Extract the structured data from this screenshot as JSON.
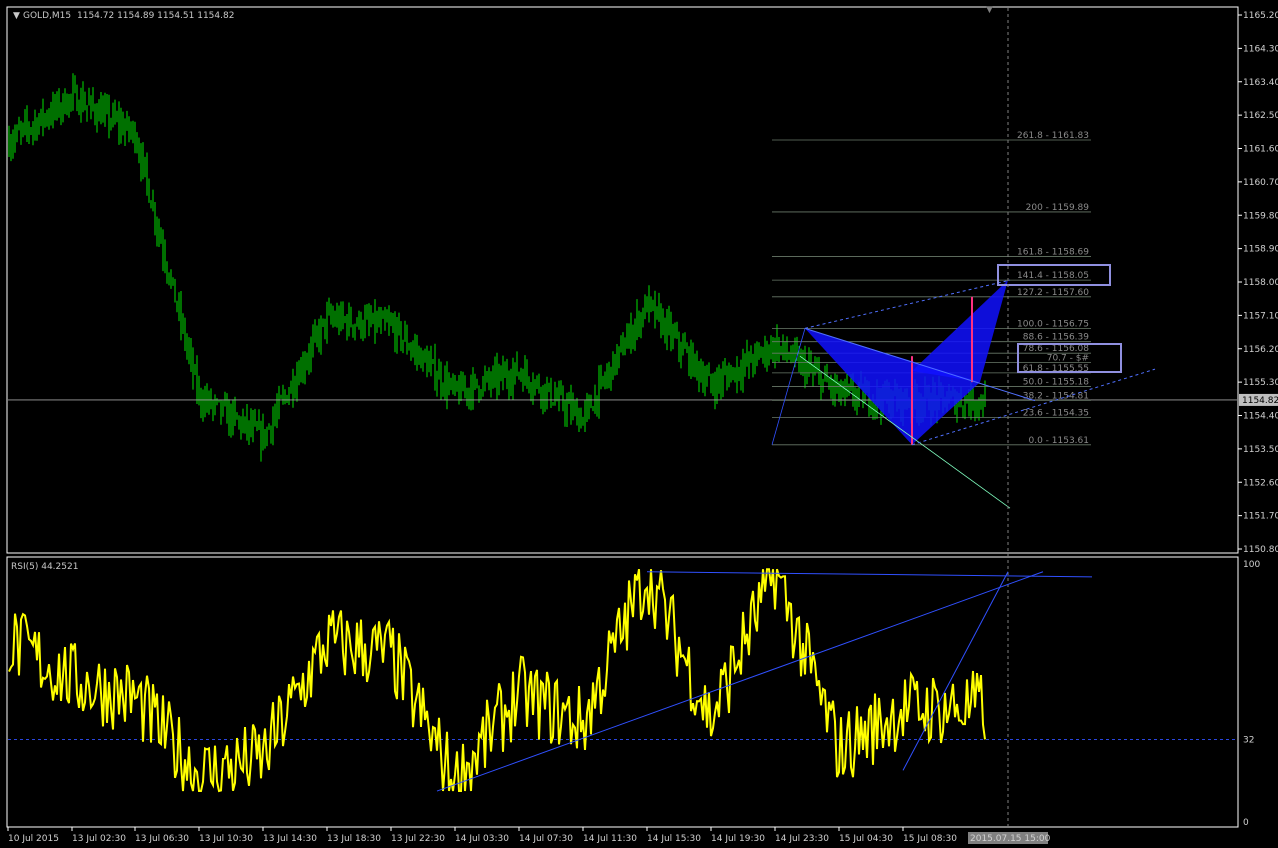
{
  "header": {
    "symbol": "GOLD,M15",
    "ohlc": "1154.72 1154.89 1154.51 1154.82"
  },
  "rsi_header": "RSI(5) 44.2521",
  "colors": {
    "background": "#000000",
    "frame": "#ffffff",
    "candles": "#00e000",
    "rsi_line": "#ffff00",
    "trend_lines": "#3050ff",
    "harmonic_fill": "#1010ff",
    "fib_lines": "#6a7a6a",
    "current_price_label_bg": "#c0c0c0",
    "time_highlight_bg": "#808080"
  },
  "chart_data": [
    {
      "type": "line",
      "subtype": "candlestick",
      "title": "GOLD,M15",
      "series": [
        {
          "name": "GOLD,M15",
          "x": [
            "10 Jul 2015",
            "13 Jul 02:30",
            "13 Jul 06:30",
            "13 Jul 10:30",
            "13 Jul 14:30",
            "13 Jul 18:30",
            "13 Jul 22:30",
            "14 Jul 03:30",
            "14 Jul 07:30",
            "14 Jul 11:30",
            "14 Jul 15:30",
            "14 Jul 19:30",
            "14 Jul 23:30",
            "15 Jul 04:30",
            "15 Jul 08:30"
          ],
          "y": [
            1161.8,
            1163.0,
            1162.0,
            1154.9,
            1153.8,
            1157.0,
            1156.8,
            1155.0,
            1155.6,
            1154.3,
            1157.4,
            1155.2,
            1156.3,
            1155.0,
            1154.8
          ]
        }
      ],
      "ylim": [
        1150.8,
        1165.2
      ],
      "yticks": [
        "1165.20",
        "1164.30",
        "1163.40",
        "1162.50",
        "1161.60",
        "1160.70",
        "1159.80",
        "1158.90",
        "1158.00",
        "1157.10",
        "1156.20",
        "1155.30",
        "1154.40",
        "1153.50",
        "1152.60",
        "1151.70",
        "1150.80"
      ],
      "xticks": [
        "10 Jul 2015",
        "13 Jul 02:30",
        "13 Jul 06:30",
        "13 Jul 10:30",
        "13 Jul 14:30",
        "13 Jul 18:30",
        "13 Jul 22:30",
        "14 Jul 03:30",
        "14 Jul 07:30",
        "14 Jul 11:30",
        "14 Jul 15:30",
        "14 Jul 19:30",
        "14 Jul 23:30",
        "15 Jul 04:30",
        "15 Jul 08:30"
      ],
      "current_price": "1154.82",
      "fib_levels": [
        {
          "label": "261.8 - 1161.83",
          "value": 1161.83
        },
        {
          "label": "200 - 1159.89",
          "value": 1159.89
        },
        {
          "label": "161.8 - 1158.69",
          "value": 1158.69
        },
        {
          "label": "141.4 - 1158.05",
          "value": 1158.05
        },
        {
          "label": "127.2 - 1157.60",
          "value": 1157.6
        },
        {
          "label": "100.0 - 1156.75",
          "value": 1156.75
        },
        {
          "label": "88.6 - 1156.39",
          "value": 1156.39
        },
        {
          "label": "78.6 - 1156.08",
          "value": 1156.08
        },
        {
          "label": "70.7 - $#",
          "value": 1155.83
        },
        {
          "label": "61.8 - 1155.55",
          "value": 1155.55
        },
        {
          "label": "50.0 - 1155.18",
          "value": 1155.18
        },
        {
          "label": "38.2 - 1154.81",
          "value": 1154.81
        },
        {
          "label": "23.6 - 1154.35",
          "value": 1154.35
        },
        {
          "label": "0.0 - 1153.61",
          "value": 1153.61
        }
      ],
      "grid": false
    },
    {
      "type": "line",
      "title": "RSI(5) 44.2521",
      "series": [
        {
          "name": "RSI(5)",
          "x": [
            "10 Jul 2015",
            "13 Jul 02:30",
            "13 Jul 06:30",
            "13 Jul 10:30",
            "13 Jul 14:30",
            "13 Jul 18:30",
            "13 Jul 22:30",
            "14 Jul 03:30",
            "14 Jul 07:30",
            "14 Jul 11:30",
            "14 Jul 15:30",
            "14 Jul 19:30",
            "14 Jul 23:30",
            "15 Jul 04:30",
            "15 Jul 08:30"
          ],
          "y": [
            70,
            55,
            48,
            18,
            25,
            70,
            65,
            15,
            50,
            38,
            97,
            40,
            97,
            28,
            44
          ]
        }
      ],
      "ylim": [
        0,
        100
      ],
      "yticks": [
        "100",
        "32",
        "0"
      ],
      "level_line": 32,
      "highlighted_time": "2015.07.15 15:00"
    }
  ]
}
